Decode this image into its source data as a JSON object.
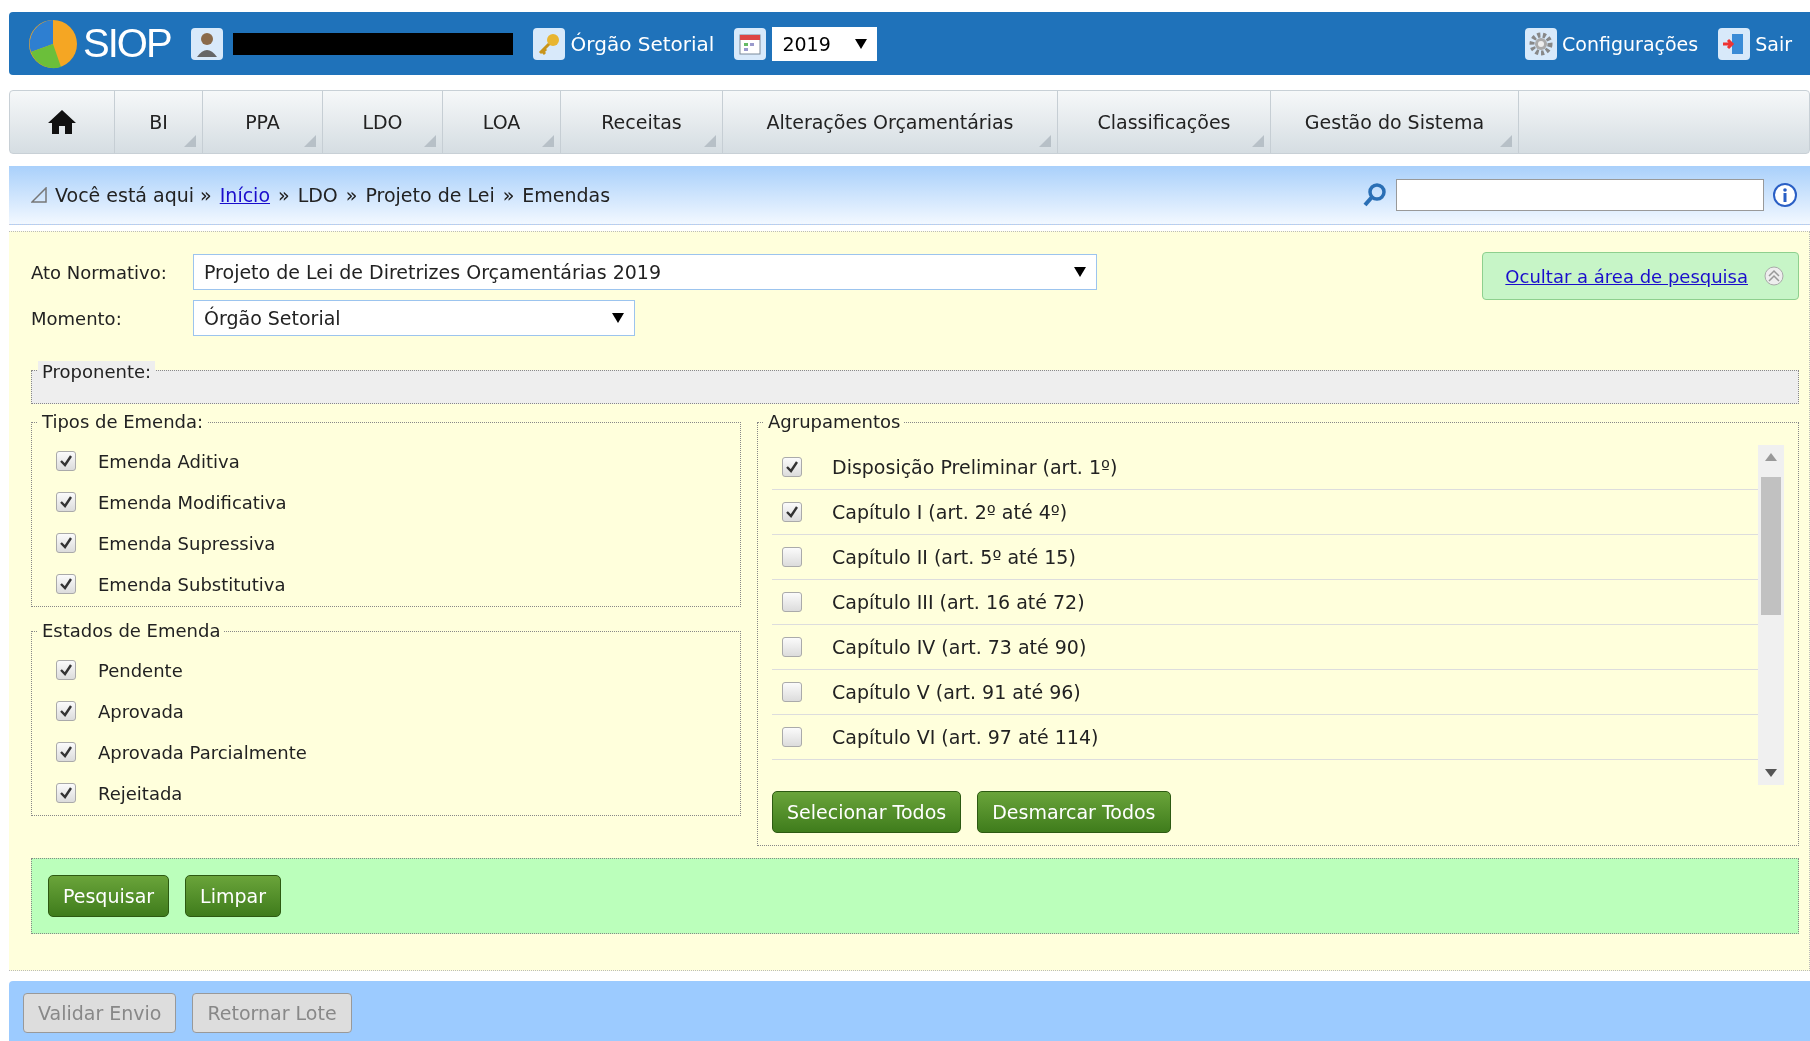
{
  "header": {
    "logo": "SIOP",
    "profile": "Órgão Setorial",
    "year": "2019",
    "links": [
      {
        "label": "Configurações",
        "kind": "settings"
      },
      {
        "label": "Sair",
        "kind": "exit"
      }
    ]
  },
  "nav": {
    "items": [
      {
        "label": "BI"
      },
      {
        "label": "PPA"
      },
      {
        "label": "LDO"
      },
      {
        "label": "LOA"
      },
      {
        "label": "Receitas"
      },
      {
        "label": "Alterações Orçamentárias"
      },
      {
        "label": "Classificações"
      },
      {
        "label": "Gestão do Sistema"
      }
    ]
  },
  "breadcrumb": {
    "prefix": "Você está aqui »",
    "separator": "»",
    "items": [
      {
        "label": "Início",
        "kind": "link"
      },
      {
        "label": "LDO",
        "kind": "text"
      },
      {
        "label": "Projeto de Lei",
        "kind": "text"
      },
      {
        "label": "Emendas",
        "kind": "text"
      }
    ]
  },
  "form": {
    "ato_normativo": {
      "label": "Ato Normativo:",
      "value": "Projeto de Lei de Diretrizes Orçamentárias 2019"
    },
    "momento": {
      "label": "Momento:",
      "value": "Órgão Setorial"
    },
    "toggle_link": "Ocultar a área de pesquisa",
    "proponente": {
      "legend": "Proponente:"
    },
    "tipos": {
      "legend": "Tipos de Emenda:",
      "options": [
        {
          "label": "Emenda Aditiva",
          "checked": true
        },
        {
          "label": "Emenda Modificativa",
          "checked": true
        },
        {
          "label": "Emenda Supressiva",
          "checked": true
        },
        {
          "label": "Emenda Substitutiva",
          "checked": true
        }
      ]
    },
    "estados": {
      "legend": "Estados de Emenda",
      "options": [
        {
          "label": "Pendente",
          "checked": true
        },
        {
          "label": "Aprovada",
          "checked": true
        },
        {
          "label": "Aprovada Parcialmente",
          "checked": true
        },
        {
          "label": "Rejeitada",
          "checked": true
        }
      ]
    },
    "agrupamentos": {
      "legend": "Agrupamentos",
      "options": [
        {
          "label": "Disposição Preliminar (art. 1º)",
          "checked": true
        },
        {
          "label": "Capítulo I (art. 2º até 4º)",
          "checked": true
        },
        {
          "label": "Capítulo II (art. 5º até 15)",
          "checked": false
        },
        {
          "label": "Capítulo III (art. 16 até 72)",
          "checked": false
        },
        {
          "label": "Capítulo IV (art. 73 até 90)",
          "checked": false
        },
        {
          "label": "Capítulo V (art. 91 até 96)",
          "checked": false
        },
        {
          "label": "Capítulo VI (art. 97 até 114)",
          "checked": false
        }
      ],
      "buttons": [
        "Selecionar Todos",
        "Desmarcar Todos"
      ]
    },
    "actions": [
      "Pesquisar",
      "Limpar"
    ]
  },
  "footer": {
    "buttons": [
      {
        "label": "Validar Envio",
        "disabled": true
      },
      {
        "label": "Retornar Lote",
        "disabled": true
      }
    ]
  }
}
